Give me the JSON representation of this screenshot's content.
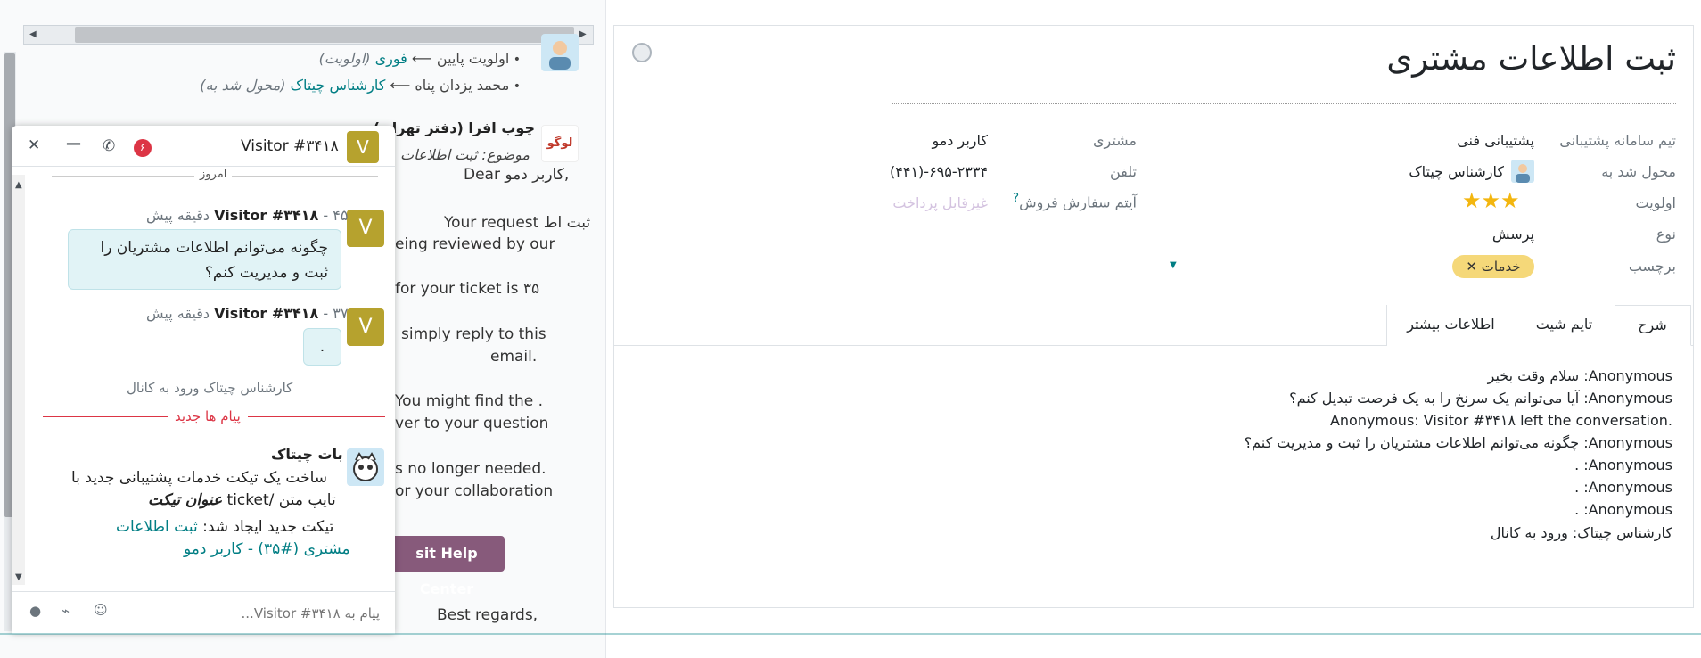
{
  "chatter": {
    "tracking_lines": [
      {
        "old": "اولویت پایین",
        "new": "فوری",
        "field": "(اولویت)"
      },
      {
        "old": "محمد یزدان پناه",
        "new": "کارشناس چیتاک",
        "field": "(محول شد به)"
      }
    ],
    "company": "چوب افرا (دفتر تهران)",
    "subject": "موضوع: ثبت اطلاعات",
    "logo_text": "لوگو",
    "email_lines": [
      "Dear کاربر دمو,",
      "Your request ثبت اط",
      "eing reviewed by our",
      "for your ticket is ۳۵",
      "simply reply to this",
      "email.",
      "You might find the .",
      "ver to your question",
      "s no longer needed.",
      "or your collaboration",
      "Best regards,"
    ],
    "help_button": "sit Help Center"
  },
  "chat": {
    "visitor_name": "Visitor #۳۴۱۸",
    "avatar_letter": "V",
    "notif_count": "۶",
    "day_separator": "امروز",
    "messages": [
      {
        "sender": "Visitor #۳۴۱۸",
        "time": " - ۴۵ دقیقه پیش",
        "text_line1": "چگونه می‌توانم اطلاعات مشتریان را",
        "text_line2": "ثبت و مدیریت کنم؟"
      },
      {
        "sender": "Visitor #۳۴۱۸",
        "time": " - ۳۷ دقیقه پیش",
        "text_line1": "."
      }
    ],
    "system_join": "کارشناس چیتاک ورود به کانال",
    "new_messages_label": "پیام ها جدید",
    "bot": {
      "name": "بات چیتاک",
      "line1": "ساخت یک تیکت خدمات پشتیبانی جدید با",
      "line2_plain": "تایپ متن /ticket",
      "line2_bold": "عنوان تیکت",
      "line3_plain": "تیکت جدید ایجاد شد:",
      "line3_link": "ثبت اطلاعات",
      "line4_link": "مشتری (#۳۵) - کاربر دمو"
    },
    "composer_placeholder": "پیام به Visitor #۳۴۱۸..."
  },
  "form": {
    "title": "ثبت اطلاعات مشتری",
    "fields_right": [
      {
        "label": "تیم سامانه پشتیبانی",
        "value": "پشتیبانی فنی"
      },
      {
        "label": "محول شد به",
        "value": "کارشناس چیتاک"
      },
      {
        "label": "اولویت",
        "value": "★★★"
      },
      {
        "label": "نوع",
        "value": "پرسش"
      },
      {
        "label": "برچسب",
        "value": "خدمات"
      }
    ],
    "fields_left": [
      {
        "label": "مشتری",
        "value": "کاربر دمو"
      },
      {
        "label": "تلفن",
        "value": "(۴۴۱)-۶۹۵-۲۳۳۴"
      },
      {
        "label": "آیتم سفارش فروش",
        "help": "?",
        "value": "غیرقابل پرداخت"
      }
    ],
    "priority_stars": 3,
    "tabs": [
      "شرح",
      "تایم شیت",
      "اطلاعات بیشتر"
    ],
    "description_lines": [
      "Anonymous: سلام وقت بخیر",
      "Anonymous: آیا می‌توانم یک سرنخ را به یک فرصت تبدیل کنم؟",
      "Anonymous: Visitor #۳۴۱۸ left the conversation.",
      "Anonymous: چگونه می‌توانم اطلاعات مشتریان را ثبت و مدیریت کنم؟",
      "Anonymous: .",
      "Anonymous: .",
      "Anonymous: .",
      "کارشناس چیتاک: ورود به کانال"
    ]
  },
  "colors": {
    "accent": "#017e84",
    "danger": "#dc3545",
    "brand": "#875a7b",
    "star": "#f3b60f"
  }
}
